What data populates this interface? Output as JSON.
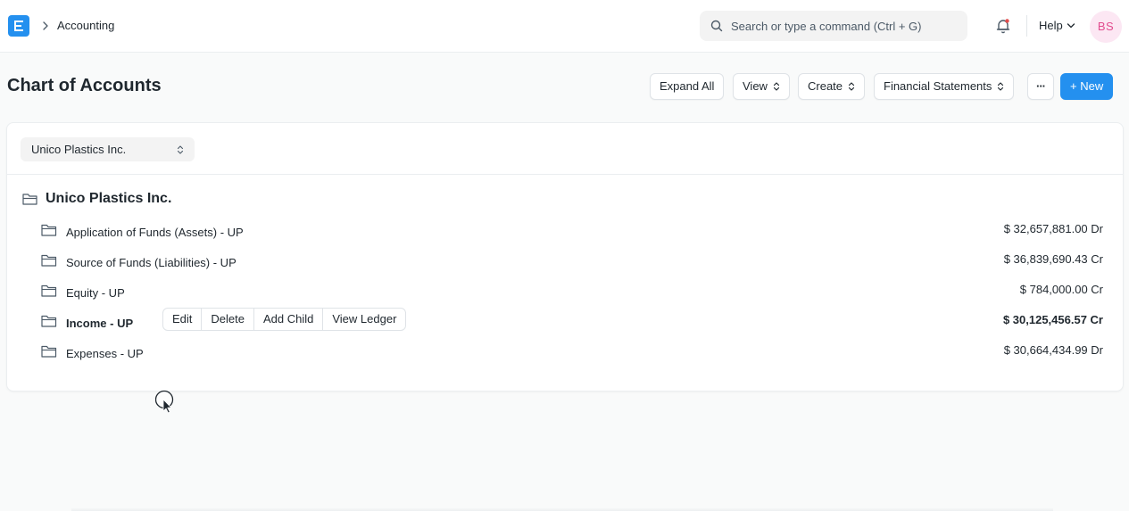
{
  "navbar": {
    "breadcrumb": "Accounting",
    "search_placeholder": "Search or type a command (Ctrl + G)",
    "help_label": "Help",
    "avatar_initials": "BS"
  },
  "page": {
    "title": "Chart of Accounts",
    "buttons": {
      "expand_all": "Expand All",
      "view": "View",
      "create": "Create",
      "financial_statements": "Financial Statements",
      "more": "···",
      "new": "+ New"
    }
  },
  "filters": {
    "company": "Unico Plastics Inc."
  },
  "tree": {
    "root": "Unico Plastics Inc.",
    "accounts": [
      {
        "name": "Application of Funds (Assets) - UP",
        "balance": "$ 32,657,881.00 Dr"
      },
      {
        "name": "Source of Funds (Liabilities) - UP",
        "balance": "$ 36,839,690.43 Cr"
      },
      {
        "name": "Equity - UP",
        "balance": "$ 784,000.00 Cr"
      },
      {
        "name": "Income - UP",
        "balance": "$ 30,125,456.57 Cr",
        "selected": true
      },
      {
        "name": "Expenses - UP",
        "balance": "$ 30,664,434.99 Dr"
      }
    ],
    "row_actions": [
      "Edit",
      "Delete",
      "Add Child",
      "View Ledger"
    ]
  },
  "colors": {
    "primary": "#2490ef",
    "avatar_bg": "#fce7f3",
    "avatar_text": "#e24c8f"
  },
  "icons": [
    "app-logo-icon",
    "chevron-right-icon",
    "search-icon",
    "bell-icon",
    "chevron-down-icon",
    "folder-open-icon",
    "folder-icon",
    "up-down-icon"
  ]
}
